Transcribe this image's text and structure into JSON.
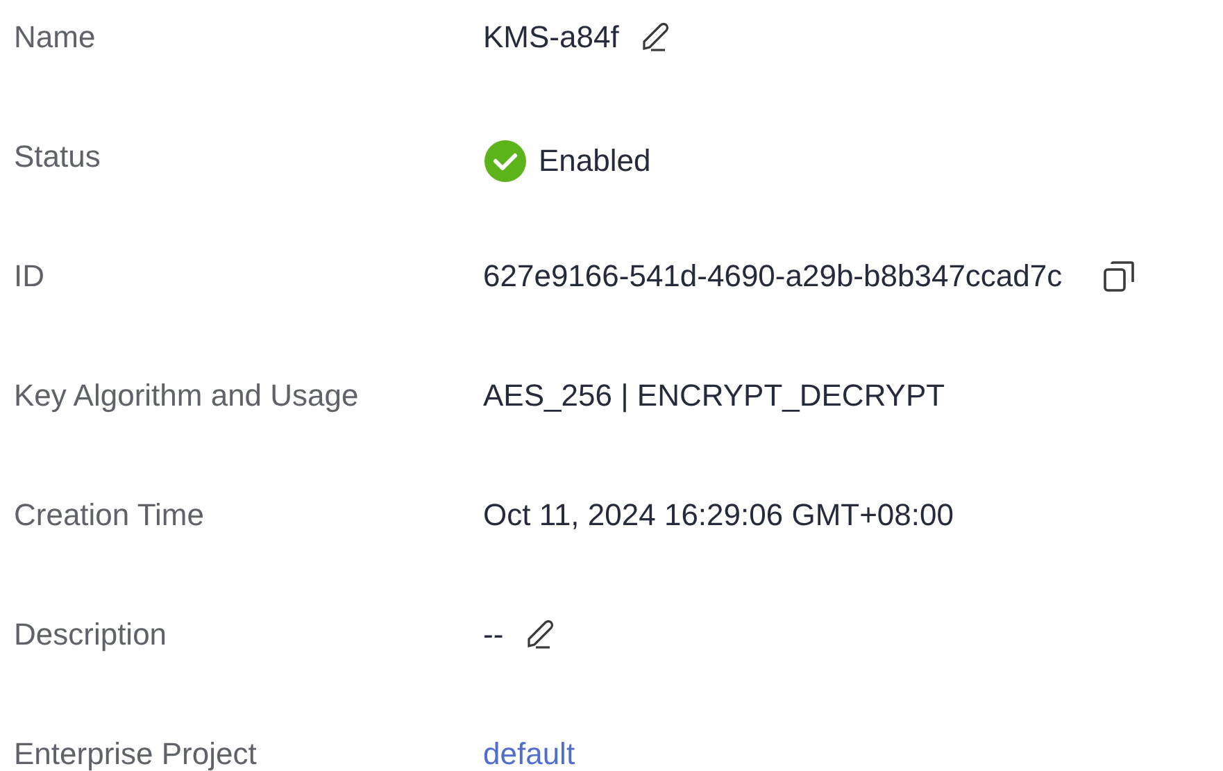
{
  "fields": [
    {
      "label": "Name",
      "value": "KMS-a84f",
      "kind": "editable"
    },
    {
      "label": "Status",
      "value": "Enabled",
      "kind": "status"
    },
    {
      "label": "ID",
      "value": "627e9166-541d-4690-a29b-b8b347ccad7c",
      "kind": "copyable"
    },
    {
      "label": "Key Algorithm and Usage",
      "value": "AES_256 | ENCRYPT_DECRYPT",
      "kind": "text"
    },
    {
      "label": "Creation Time",
      "value": "Oct 11, 2024 16:29:06 GMT+08:00",
      "kind": "text"
    },
    {
      "label": "Description",
      "value": "--",
      "kind": "editable"
    },
    {
      "label": "Enterprise Project",
      "value": "default",
      "kind": "link"
    }
  ]
}
